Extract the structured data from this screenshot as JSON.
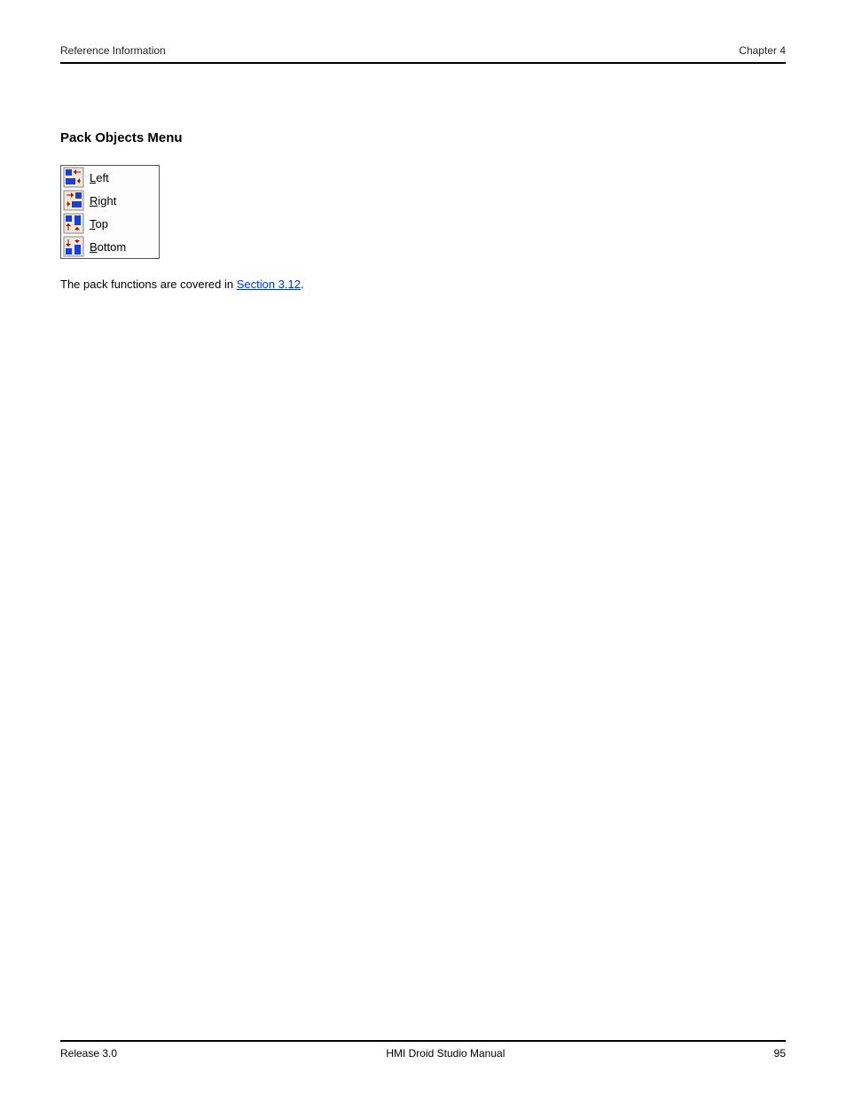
{
  "header": {
    "left": "Reference Information",
    "right": "Chapter 4"
  },
  "heading": "Pack Objects Menu",
  "menu": {
    "items": [
      {
        "mnemonic": "L",
        "rest": "eft",
        "icon": "pack-left"
      },
      {
        "mnemonic": "R",
        "rest": "ight",
        "icon": "pack-right"
      },
      {
        "mnemonic": "T",
        "rest": "op",
        "icon": "pack-top"
      },
      {
        "mnemonic": "B",
        "rest": "ottom",
        "icon": "pack-bottom"
      }
    ]
  },
  "paragraph": {
    "text_before": "The pack functions are covered in ",
    "link_text": "Section 3.12",
    "text_after": "."
  },
  "footer": {
    "left": "Release 3.0",
    "center": "HMI Droid Studio Manual",
    "right": "95"
  }
}
